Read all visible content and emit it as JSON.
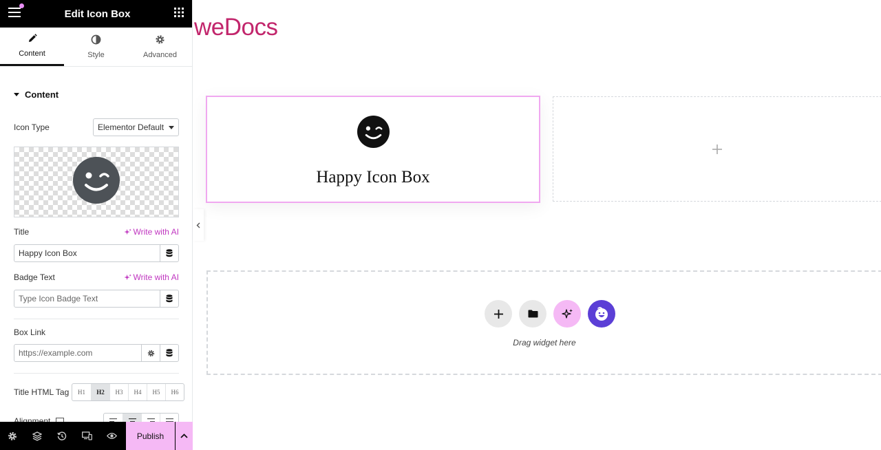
{
  "panel": {
    "title": "Edit Icon Box",
    "tabs": [
      {
        "label": "Content",
        "icon": "pencil-icon",
        "active": true
      },
      {
        "label": "Style",
        "icon": "half-circle-icon",
        "active": false
      },
      {
        "label": "Advanced",
        "icon": "gear-icon",
        "active": false
      }
    ],
    "section_title": "Content",
    "icon_type": {
      "label": "Icon Type",
      "value": "Elementor Default"
    },
    "title_field": {
      "label": "Title",
      "ai_label": "Write with AI",
      "value": "Happy Icon Box"
    },
    "badge_field": {
      "label": "Badge Text",
      "ai_label": "Write with AI",
      "placeholder": "Type Icon Badge Text"
    },
    "link_field": {
      "label": "Box Link",
      "placeholder": "https://example.com"
    },
    "html_tag": {
      "label": "Title HTML Tag",
      "options": [
        "H1",
        "H2",
        "H3",
        "H4",
        "H5",
        "H6"
      ],
      "selected": "H2"
    },
    "alignment": {
      "label": "Alignment",
      "selected": "center"
    },
    "footer": {
      "publish_label": "Publish"
    }
  },
  "canvas": {
    "site_title": "weDocs",
    "icon_box": {
      "title": "Happy Icon Box"
    },
    "drop_zone": {
      "text": "Drag widget here"
    }
  },
  "colors": {
    "accent_pink": "#f5b9f5",
    "box_border": "#f0a8f0",
    "site_title": "#c2266c",
    "ai_link": "#c036c0",
    "happy_purple": "#5b3fd6"
  }
}
